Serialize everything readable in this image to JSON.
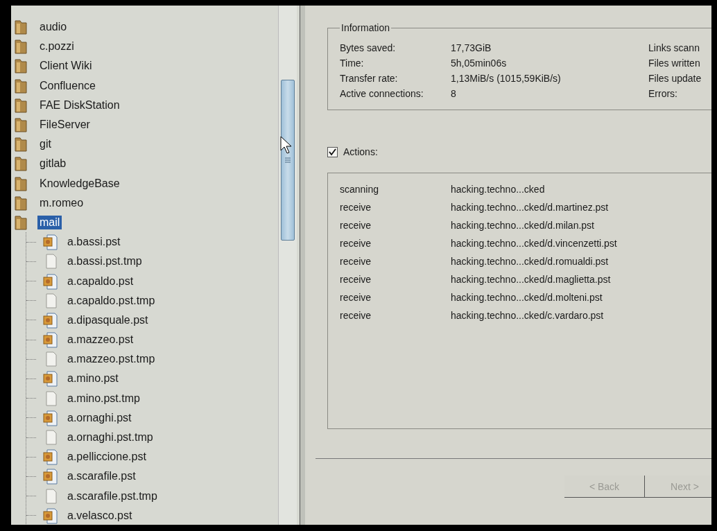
{
  "tree": {
    "items": [
      {
        "label": "audio",
        "kind": "folder",
        "selected": false
      },
      {
        "label": "c.pozzi",
        "kind": "folder",
        "selected": false
      },
      {
        "label": "Client Wiki",
        "kind": "folder",
        "selected": false
      },
      {
        "label": "Confluence",
        "kind": "folder",
        "selected": false
      },
      {
        "label": "FAE DiskStation",
        "kind": "folder",
        "selected": false
      },
      {
        "label": "FileServer",
        "kind": "folder",
        "selected": false
      },
      {
        "label": "git",
        "kind": "folder",
        "selected": false
      },
      {
        "label": "gitlab",
        "kind": "folder",
        "selected": false
      },
      {
        "label": "KnowledgeBase",
        "kind": "folder",
        "selected": false
      },
      {
        "label": "m.romeo",
        "kind": "folder",
        "selected": false
      },
      {
        "label": "mail",
        "kind": "folder",
        "selected": true,
        "children": [
          {
            "label": "a.bassi.pst",
            "kind": "pst",
            "selected": false
          },
          {
            "label": "a.bassi.pst.tmp",
            "kind": "tmp",
            "selected": false
          },
          {
            "label": "a.capaldo.pst",
            "kind": "pst",
            "selected": false
          },
          {
            "label": "a.capaldo.pst.tmp",
            "kind": "tmp",
            "selected": false
          },
          {
            "label": "a.dipasquale.pst",
            "kind": "pst",
            "selected": false
          },
          {
            "label": "a.mazzeo.pst",
            "kind": "pst",
            "selected": false
          },
          {
            "label": "a.mazzeo.pst.tmp",
            "kind": "tmp",
            "selected": false
          },
          {
            "label": "a.mino.pst",
            "kind": "pst",
            "selected": false
          },
          {
            "label": "a.mino.pst.tmp",
            "kind": "tmp",
            "selected": false
          },
          {
            "label": "a.ornaghi.pst",
            "kind": "pst",
            "selected": false
          },
          {
            "label": "a.ornaghi.pst.tmp",
            "kind": "tmp",
            "selected": false
          },
          {
            "label": "a.pelliccione.pst",
            "kind": "pst",
            "selected": false
          },
          {
            "label": "a.scarafile.pst",
            "kind": "pst",
            "selected": false
          },
          {
            "label": "a.scarafile.pst.tmp",
            "kind": "tmp",
            "selected": false
          },
          {
            "label": "a.velasco.pst",
            "kind": "pst",
            "selected": false
          }
        ]
      }
    ]
  },
  "information": {
    "title": "Information",
    "rows": [
      {
        "label": "Bytes saved:",
        "value": "17,73GiB"
      },
      {
        "label": "Time:",
        "value": "5h,05min06s"
      },
      {
        "label": "Transfer rate:",
        "value": "1,13MiB/s (1015,59KiB/s)"
      },
      {
        "label": "Active connections:",
        "value": "8"
      }
    ],
    "side_labels": [
      "Links scann",
      "Files written",
      "Files update",
      "Errors:"
    ]
  },
  "actions": {
    "label": "Actions:",
    "checked": true,
    "rows": [
      {
        "action": "scanning",
        "path": "hacking.techno...cked"
      },
      {
        "action": "receive",
        "path": "hacking.techno...cked/d.martinez.pst"
      },
      {
        "action": "receive",
        "path": "hacking.techno...cked/d.milan.pst"
      },
      {
        "action": "receive",
        "path": "hacking.techno...cked/d.vincenzetti.pst"
      },
      {
        "action": "receive",
        "path": "hacking.techno...cked/d.romualdi.pst"
      },
      {
        "action": "receive",
        "path": "hacking.techno...cked/d.maglietta.pst"
      },
      {
        "action": "receive",
        "path": "hacking.techno...cked/d.molteni.pst"
      },
      {
        "action": "receive",
        "path": "hacking.techno...cked/c.vardaro.pst"
      }
    ]
  },
  "buttons": [
    {
      "label": "< Back",
      "disabled": true
    },
    {
      "label": "Next >",
      "disabled": true
    }
  ]
}
